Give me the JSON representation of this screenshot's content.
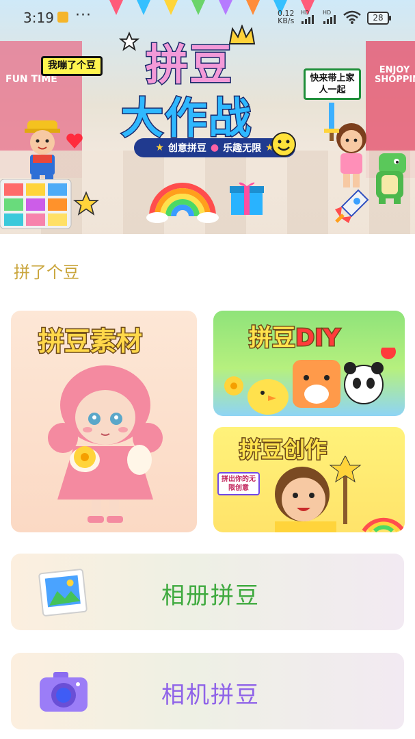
{
  "status_bar": {
    "time": "3:19",
    "dots": "···",
    "net_speed_value": "0.12",
    "net_speed_unit": "KB/s",
    "hd1": "HD",
    "hd2": "HD",
    "battery": "28"
  },
  "banner": {
    "title_line1": "拼豆",
    "title_line2": "大作战",
    "tagline_left": "创意拼豆",
    "tagline_right": "乐趣无限",
    "bubble_left": "我嘣了个豆",
    "bubble_right": "快来带上家人一起",
    "sign_left": "FUN TIME",
    "sign_right": "ENJOY SHOPPING"
  },
  "section_title": "拼了个豆",
  "cards": {
    "material": "拼豆素材",
    "diy_cn": "拼豆",
    "diy_en": "DIY",
    "create": "拼豆创作",
    "create_bubble": "拼出你的无限创意"
  },
  "actions": {
    "album": "相册拼豆",
    "camera": "相机拼豆"
  },
  "colors": {
    "section_title": "#c9a43a",
    "album_text": "#3faa3f",
    "camera_text": "#8f63e8"
  }
}
